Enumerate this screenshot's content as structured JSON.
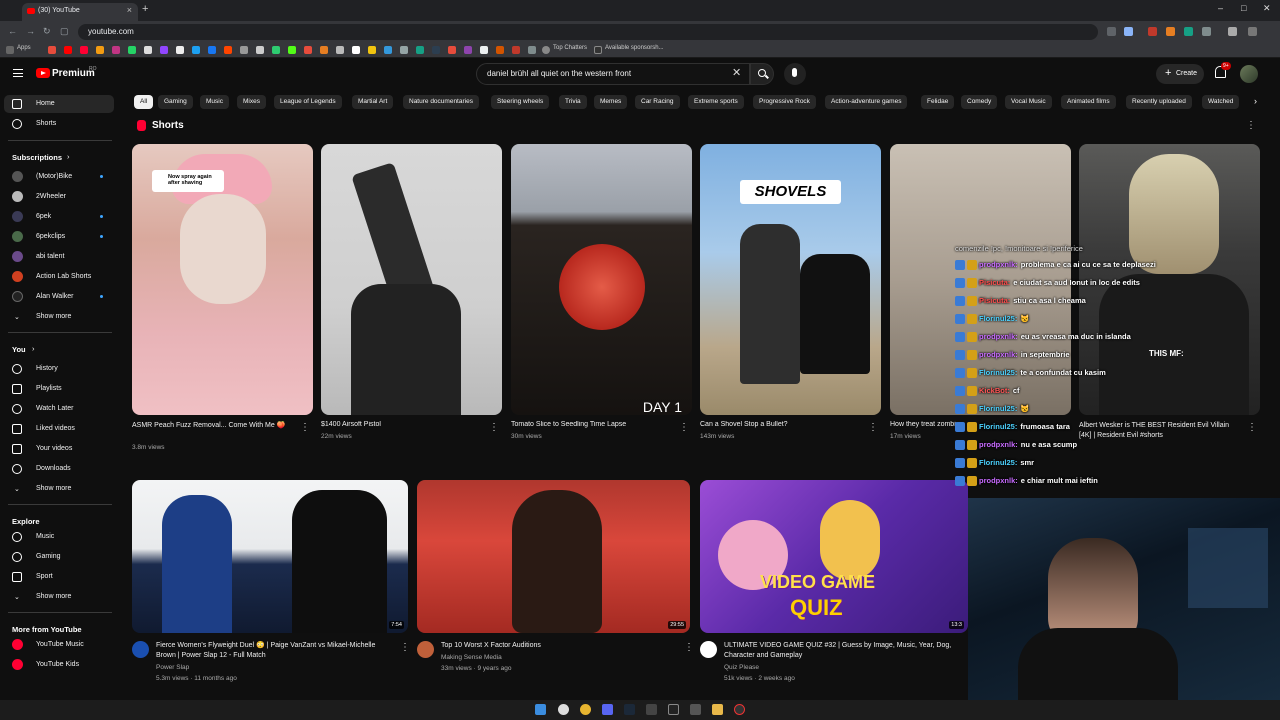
{
  "browser": {
    "tab_title": "(30) YouTube",
    "new_tab": "+",
    "url": "youtube.com",
    "bookmarks": [
      {
        "label": "Apps"
      },
      {
        "label": "Top Chatters"
      },
      {
        "label": "Available sponsorsh..."
      }
    ],
    "window_controls": {
      "minimize": "–",
      "maximize": "□",
      "close": "✕"
    }
  },
  "header": {
    "logo_text": "Premium",
    "logo_sup": "RO",
    "search_value": "daniel brühl all quiet on the western front",
    "create_label": "Create",
    "notifications_badge": "9+"
  },
  "sidebar": {
    "main": [
      {
        "label": "Home",
        "icon": "home-icon",
        "active": true
      },
      {
        "label": "Shorts",
        "icon": "shorts-icon"
      }
    ],
    "subscriptions_heading": "Subscriptions",
    "subscriptions": [
      {
        "label": "(Motor)Bike",
        "color": "#555555",
        "dot": true
      },
      {
        "label": "2Wheeler",
        "color": "#bbbbbb",
        "dot": false
      },
      {
        "label": "6pek",
        "color": "#3a3a55",
        "dot": true
      },
      {
        "label": "6pekclips",
        "color": "#4a6a4a",
        "dot": true
      },
      {
        "label": "abi talent",
        "color": "#6a4a8a",
        "dot": false
      },
      {
        "label": "Action Lab Shorts",
        "color": "#d04020",
        "dot": false
      },
      {
        "label": "Alan Walker",
        "color": "#222222",
        "dot": true
      }
    ],
    "show_more": "Show more",
    "you_heading": "You",
    "you": [
      {
        "label": "History",
        "icon": "history-icon"
      },
      {
        "label": "Playlists",
        "icon": "playlists-icon"
      },
      {
        "label": "Watch Later",
        "icon": "watch-later-icon"
      },
      {
        "label": "Liked videos",
        "icon": "like-icon"
      },
      {
        "label": "Your videos",
        "icon": "your-videos-icon"
      },
      {
        "label": "Downloads",
        "icon": "download-icon"
      }
    ],
    "explore_heading": "Explore",
    "explore": [
      {
        "label": "Music",
        "icon": "music-icon"
      },
      {
        "label": "Gaming",
        "icon": "gaming-icon"
      },
      {
        "label": "Sport",
        "icon": "trophy-icon"
      }
    ],
    "more_heading": "More from YouTube",
    "more": [
      {
        "label": "YouTube Music",
        "color": "#ff0033"
      },
      {
        "label": "YouTube Kids",
        "color": "#ff0033"
      }
    ]
  },
  "chips": [
    "All",
    "Gaming",
    "Music",
    "Mixes",
    "League of Legends",
    "Martial Art",
    "Nature documentaries",
    "Steering wheels",
    "Trivia",
    "Memes",
    "Car Racing",
    "Extreme sports",
    "Progressive Rock",
    "Action-adventure games",
    "Felidae",
    "Comedy",
    "Vocal Music",
    "Animated films",
    "Recently uploaded",
    "Watched"
  ],
  "shorts": {
    "heading": "Shorts",
    "items": [
      {
        "title": "ASMR Peach Fuzz Removal... Come With Me 🍑",
        "views": "3.8m views",
        "overlay": "Now spray again after shaving"
      },
      {
        "title": "$1400 Airsoft Pistol",
        "views": "22m views",
        "overlay": ""
      },
      {
        "title": "Tomato Slice to Seedling Time Lapse",
        "views": "30m views",
        "overlay": "DAY 1"
      },
      {
        "title": "Can a Shovel Stop a Bullet?",
        "views": "143m views",
        "overlay": "SHOVELS"
      },
      {
        "title": "How they treat zombie...",
        "views": "17m views",
        "overlay": ""
      },
      {
        "title": "Albert Wesker is THE BEST Resident Evil Villain [4K] | Resident Evil #shorts",
        "views": "",
        "overlay": "THIS MF:"
      }
    ]
  },
  "videos": [
    {
      "title": "Fierce Women's Flyweight Duel 😳 | Paige VanZant vs Mikael-Michelle Brown | Power Slap 12 - Full Match",
      "channel": "Power Slap",
      "meta": "5.3m views · 11 months ago",
      "duration": "7:54",
      "avatar_color": "#1a4fb0"
    },
    {
      "title": "Top 10 Worst X Factor Auditions",
      "channel": "Making Sense Media",
      "meta": "33m views · 9 years ago",
      "duration": "29:55",
      "avatar_color": "#c0603a"
    },
    {
      "title": "ULTIMATE VIDEO GAME QUIZ #32 | Guess by Image, Music, Year, Dog, Character and Gameplay",
      "channel": "Quiz Please",
      "meta": "51k views · 2 weeks ago",
      "duration": "13:3",
      "avatar_color": "#ffffff"
    }
  ],
  "chat": {
    "header": "comenzile !pc, !monitoare si !periferice",
    "lines": [
      {
        "user": "prodpxnlk:",
        "color": "#c86bff",
        "msg": "problema e ca ai cu ce sa te deplasezi"
      },
      {
        "user": "Pisicuta:",
        "color": "#ff4d4d",
        "msg": "e ciudat sa aud Ionut in loc de edits"
      },
      {
        "user": "Pisicuta:",
        "color": "#ff4d4d",
        "msg": "stiu ca asa l cheama"
      },
      {
        "user": "Florinul25:",
        "color": "#4dd2ff",
        "msg": "😼"
      },
      {
        "user": "prodpxnlk:",
        "color": "#c86bff",
        "msg": "eu as vreasa ma duc in islanda"
      },
      {
        "user": "prodpxnlk:",
        "color": "#c86bff",
        "msg": "in septembrie"
      },
      {
        "user": "Florinul25:",
        "color": "#4dd2ff",
        "msg": "te a confundat cu kasim"
      },
      {
        "user": "KickBot:",
        "color": "#ff5555",
        "msg": "cf"
      },
      {
        "user": "Florinul25:",
        "color": "#4dd2ff",
        "msg": "😼"
      },
      {
        "user": "Florinul25:",
        "color": "#4dd2ff",
        "msg": "frumoasa tara"
      },
      {
        "user": "prodpxnlk:",
        "color": "#c86bff",
        "msg": "nu e asa scump"
      },
      {
        "user": "Florinul25:",
        "color": "#4dd2ff",
        "msg": "smr"
      },
      {
        "user": "prodpxnlk:",
        "color": "#c86bff",
        "msg": "e chiar mult mai ieftin"
      }
    ]
  }
}
